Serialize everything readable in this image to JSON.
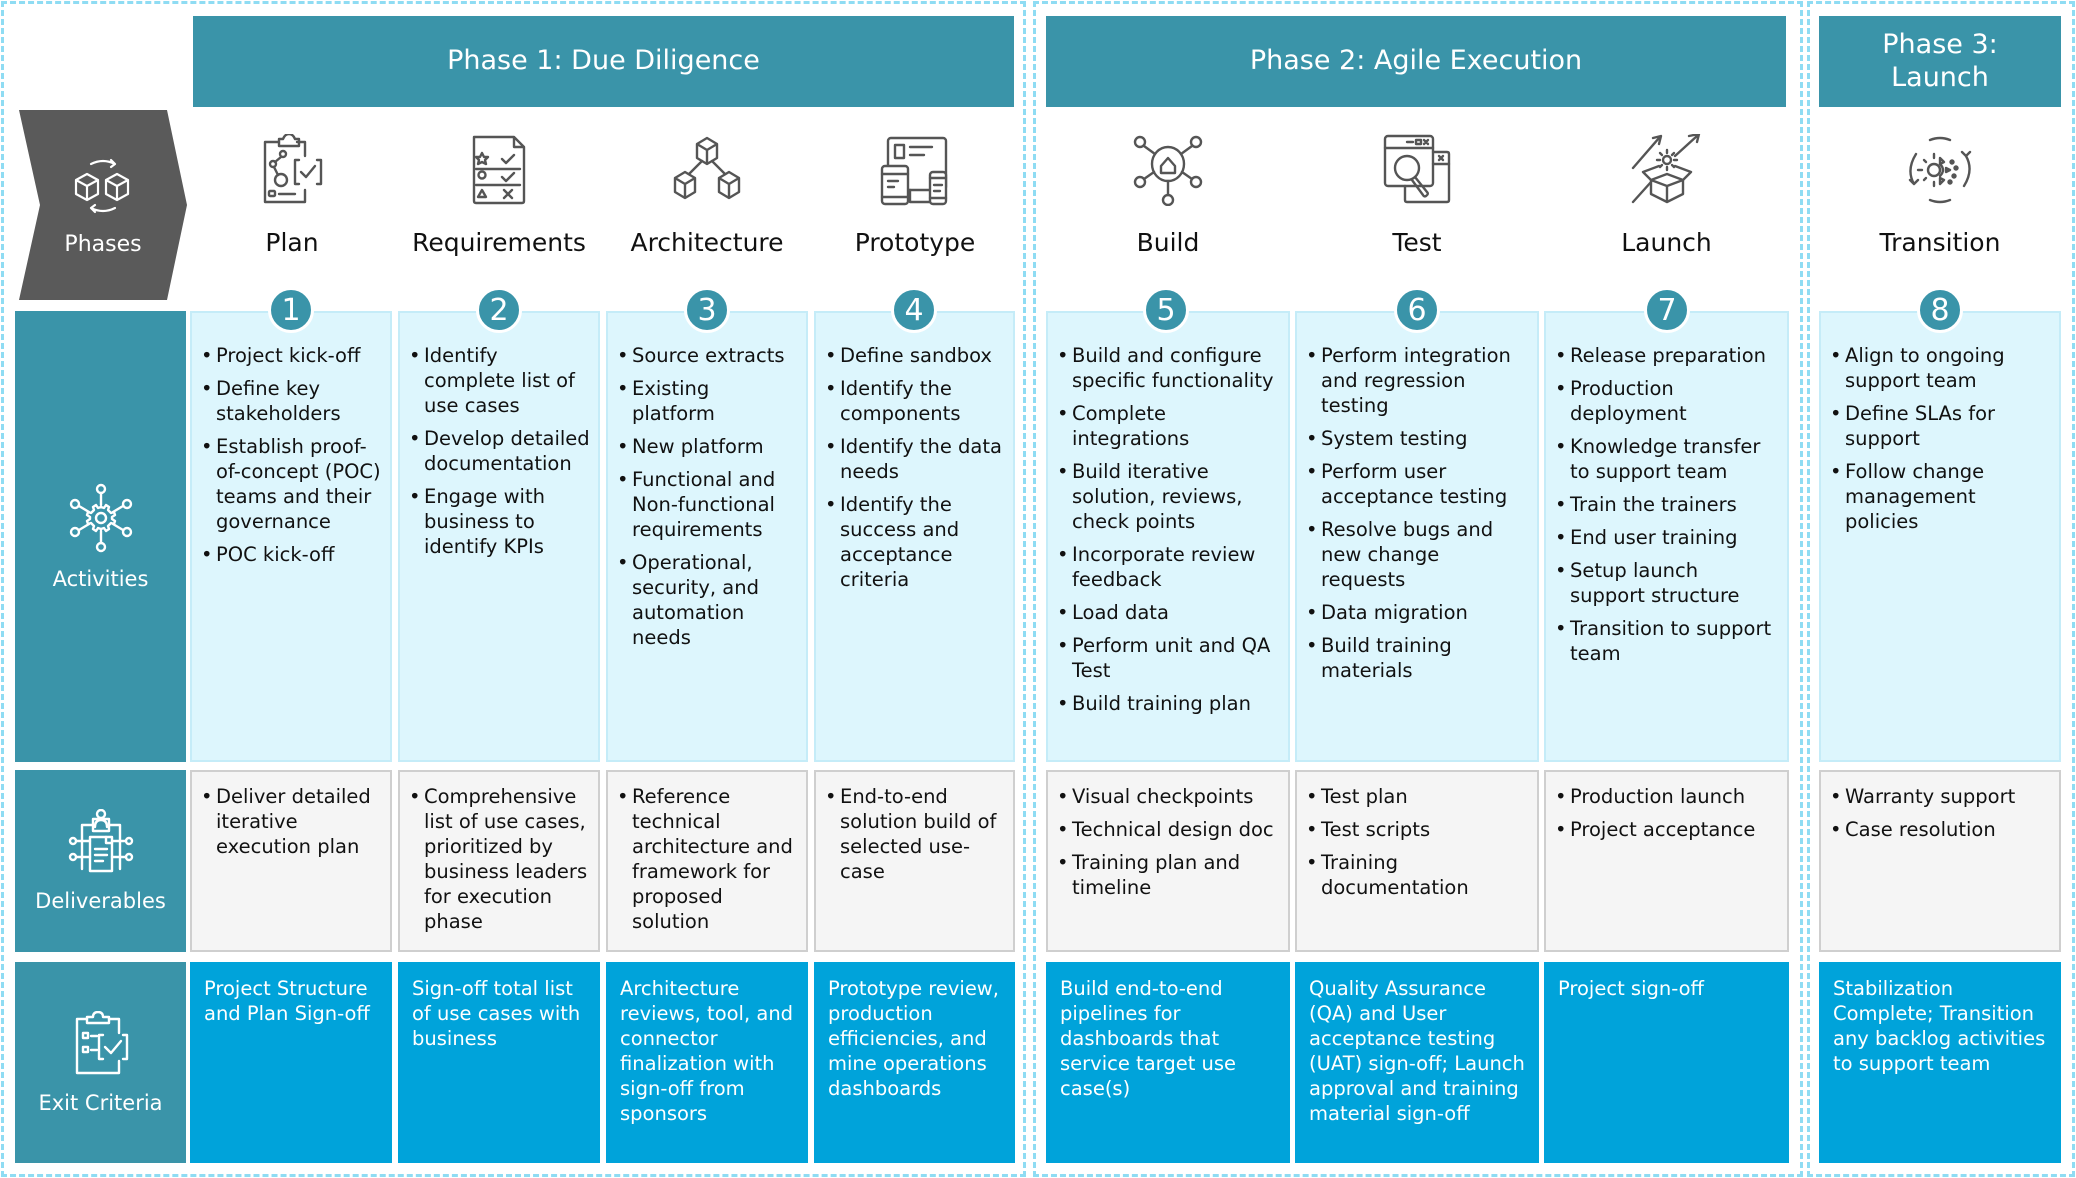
{
  "phases": [
    {
      "label": "Phase 1: Due Diligence"
    },
    {
      "label": "Phase 2: Agile Execution"
    },
    {
      "label": "Phase 3: Launch"
    }
  ],
  "row_labels": {
    "phases": "Phases",
    "activities": "Activities",
    "deliverables": "Deliverables",
    "exit_criteria": "Exit Criteria"
  },
  "steps": [
    {
      "number": "1",
      "title": "Plan",
      "icon": "clipboard-plan-icon",
      "activities": [
        "Project kick-off",
        "Define key stakeholders",
        "Establish proof-of-concept (POC) teams and their governance",
        "POC kick-off"
      ],
      "deliverables": [
        "Deliver detailed iterative execution plan"
      ],
      "exit_criteria": "Project Structure and Plan Sign-off"
    },
    {
      "number": "2",
      "title": "Requirements",
      "icon": "checklist-icon",
      "activities": [
        "Identify complete list of use cases",
        "Develop detailed documentation",
        "Engage with business to identify KPIs"
      ],
      "deliverables": [
        "Comprehensive list of use cases, prioritized by business leaders for execution phase"
      ],
      "exit_criteria": "Sign-off total list of use cases with business"
    },
    {
      "number": "3",
      "title": "Architecture",
      "icon": "cubes-hierarchy-icon",
      "activities": [
        "Source extracts",
        "Existing platform",
        "New platform",
        "Functional and Non-functional requirements",
        "Operational, security, and automation needs"
      ],
      "deliverables": [
        "Reference technical architecture and framework for proposed solution"
      ],
      "exit_criteria": "Architecture reviews, tool, and connector finalization with sign-off from sponsors"
    },
    {
      "number": "4",
      "title": "Prototype",
      "icon": "devices-icon",
      "activities": [
        "Define sandbox",
        "Identify the components",
        "Identify the data needs",
        "Identify the success and acceptance criteria"
      ],
      "deliverables": [
        "End-to-end solution build of selected use-case"
      ],
      "exit_criteria": "Prototype review, production efficiencies, and mine operations dashboards"
    },
    {
      "number": "5",
      "title": "Build",
      "icon": "network-hub-icon",
      "activities": [
        "Build and configure specific functionality",
        "Complete integrations",
        "Build iterative solution, reviews, check points",
        "Incorporate review feedback",
        "Load data",
        "Perform unit and QA Test",
        "Build training plan"
      ],
      "deliverables": [
        "Visual checkpoints",
        "Technical design doc",
        "Training plan and timeline"
      ],
      "exit_criteria": "Build  end-to-end pipelines for dashboards that service target use case(s)"
    },
    {
      "number": "6",
      "title": "Test",
      "icon": "window-search-icon",
      "activities": [
        "Perform integration and regression testing",
        "System testing",
        "Perform user acceptance testing",
        "Resolve bugs and new change requests",
        "Data migration",
        "Build training materials"
      ],
      "deliverables": [
        "Test plan",
        "Test scripts",
        "Training documentation"
      ],
      "exit_criteria": "Quality Assurance (QA) and User acceptance testing (UAT) sign-off; Launch approval and training material sign-off"
    },
    {
      "number": "7",
      "title": "Launch",
      "icon": "box-launch-icon",
      "activities": [
        "Release preparation",
        "Production deployment",
        "Knowledge transfer to support team",
        "Train the trainers",
        "End user training",
        "Setup launch support structure",
        "Transition to support team"
      ],
      "deliverables": [
        "Production launch",
        "Project acceptance"
      ],
      "exit_criteria": "Project sign-off"
    },
    {
      "number": "8",
      "title": "Transition",
      "icon": "gear-cycle-icon",
      "activities": [
        "Align to ongoing support team",
        "Define SLAs for support",
        "Follow change management policies"
      ],
      "deliverables": [
        "Warranty support",
        "Case resolution"
      ],
      "exit_criteria": "Stabilization Complete; Transition any backlog activities to support team"
    }
  ],
  "colors": {
    "header_teal": "#3a94a9",
    "activities_bg": "#ddf6fd",
    "deliverables_bg": "#f5f5f5",
    "exit_bg": "#00a3da",
    "phases_chevron": "#5a5a5a",
    "dashed_border": "#8fdcf3"
  }
}
